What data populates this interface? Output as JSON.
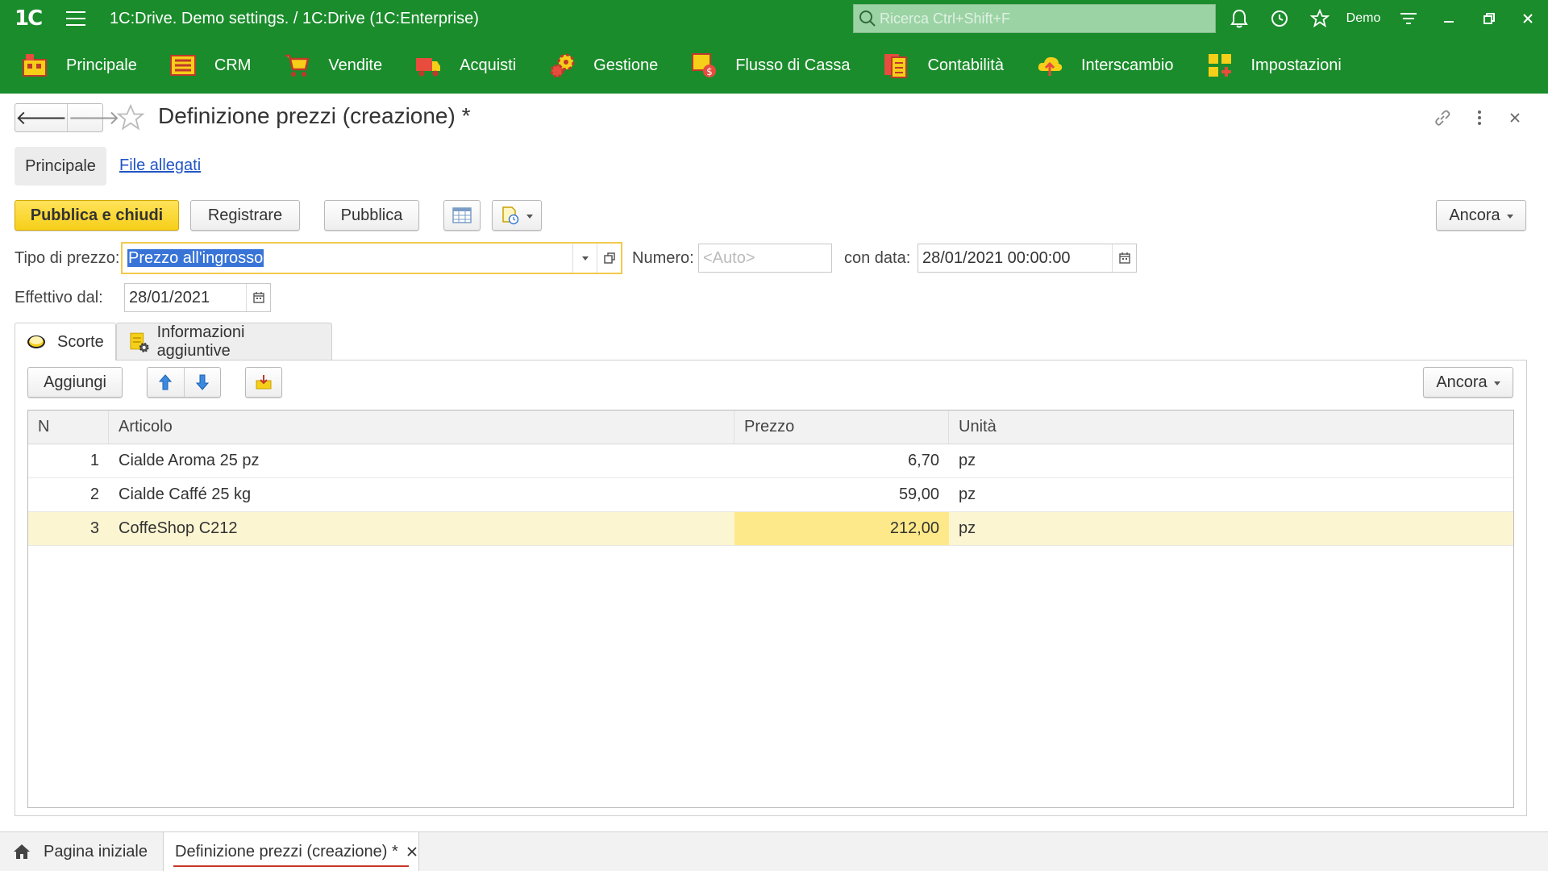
{
  "titlebar": {
    "logo": "1C",
    "app_title": "1C:Drive. Demo settings. / 1C:Drive  (1C:Enterprise)",
    "search_placeholder": "Ricerca Ctrl+Shift+F",
    "user_name": "Demo"
  },
  "sections": [
    {
      "label": "Principale",
      "icon": "home-section-icon"
    },
    {
      "label": "CRM",
      "icon": "crm-section-icon"
    },
    {
      "label": "Vendite",
      "icon": "cart-section-icon"
    },
    {
      "label": "Acquisti",
      "icon": "truck-section-icon"
    },
    {
      "label": "Gestione",
      "icon": "gears-section-icon"
    },
    {
      "label": "Flusso di Cassa",
      "icon": "cash-section-icon"
    },
    {
      "label": "Contabilità",
      "icon": "ledger-section-icon"
    },
    {
      "label": "Interscambio",
      "icon": "cloud-exchange-section-icon"
    },
    {
      "label": "Impostazioni",
      "icon": "settings-section-icon"
    }
  ],
  "form": {
    "title": "Definizione prezzi (creazione) *",
    "tabs": {
      "main": "Principale",
      "attachments": "File allegati"
    },
    "commands": {
      "post_close": "Pubblica e chiudi",
      "save": "Registrare",
      "post": "Pubblica",
      "more": "Ancora"
    },
    "fields": {
      "price_type_label": "Tipo di prezzo:",
      "price_type_value": "Prezzo all'ingrosso",
      "number_label": "Numero:",
      "number_placeholder": "<Auto>",
      "date_label": "con data:",
      "date_value": "28/01/2021 00:00:00",
      "effective_label": "Effettivo dal:",
      "effective_value": "28/01/2021"
    },
    "inner_tabs": {
      "stock": "Scorte",
      "extra": "Informazioni aggiuntive"
    },
    "table_commands": {
      "add": "Aggiungi",
      "more": "Ancora"
    },
    "table": {
      "columns": [
        "N",
        "Articolo",
        "Prezzo",
        "Unità"
      ],
      "rows": [
        {
          "n": "1",
          "item": "Cialde Aroma 25 pz",
          "price": "6,70",
          "unit": "pz",
          "selected": false
        },
        {
          "n": "2",
          "item": "Cialde Caffé 25 kg",
          "price": "59,00",
          "unit": "pz",
          "selected": false
        },
        {
          "n": "3",
          "item": "CoffeShop C212",
          "price": "212,00",
          "unit": "pz",
          "selected": true
        }
      ]
    }
  },
  "bottom_tabs": {
    "home": "Pagina iniziale",
    "current": "Definizione prezzi (creazione) *"
  },
  "colors": {
    "brand_green": "#1a8c2b",
    "primary_yellow": "#f6cf19",
    "selected_row": "#fcf5d2",
    "link_blue": "#2255c4"
  }
}
